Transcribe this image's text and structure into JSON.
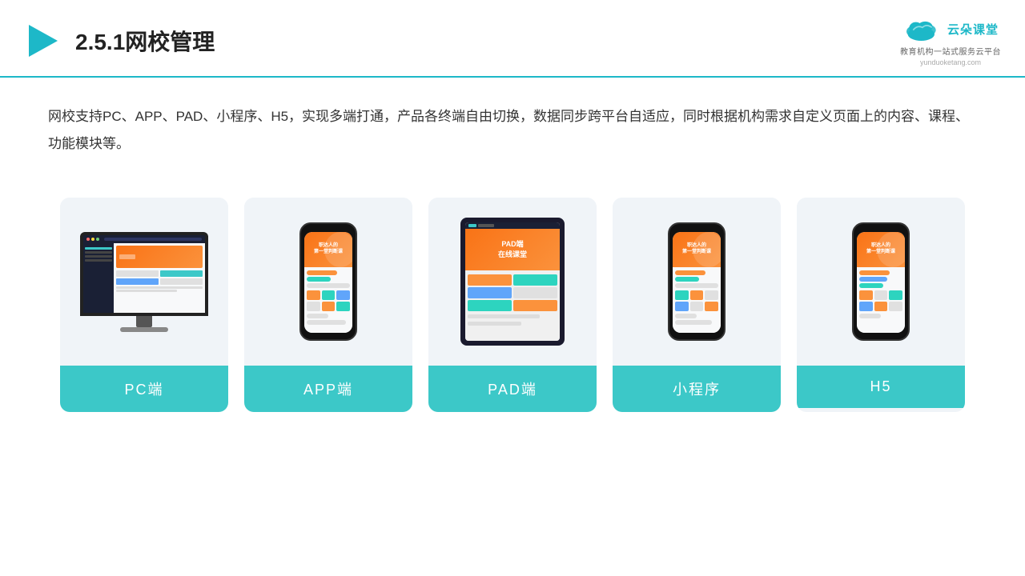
{
  "header": {
    "title": "2.5.1网校管理",
    "logo_name": "云朵课堂",
    "logo_url": "yunduoketang.com",
    "logo_tagline": "教育机构一站式服务云平台"
  },
  "description": {
    "text": "网校支持PC、APP、PAD、小程序、H5，实现多端打通，产品各终端自由切换，数据同步跨平台自适应，同时根据机构需求自定义页面上的内容、课程、功能模块等。"
  },
  "cards": [
    {
      "id": "pc",
      "label": "PC端"
    },
    {
      "id": "app",
      "label": "APP端"
    },
    {
      "id": "pad",
      "label": "PAD端"
    },
    {
      "id": "miniprogram",
      "label": "小程序"
    },
    {
      "id": "h5",
      "label": "H5"
    }
  ],
  "colors": {
    "accent": "#3cc8c8",
    "header_line": "#1db8c8",
    "text_primary": "#333",
    "card_bg": "#f0f4f8"
  }
}
